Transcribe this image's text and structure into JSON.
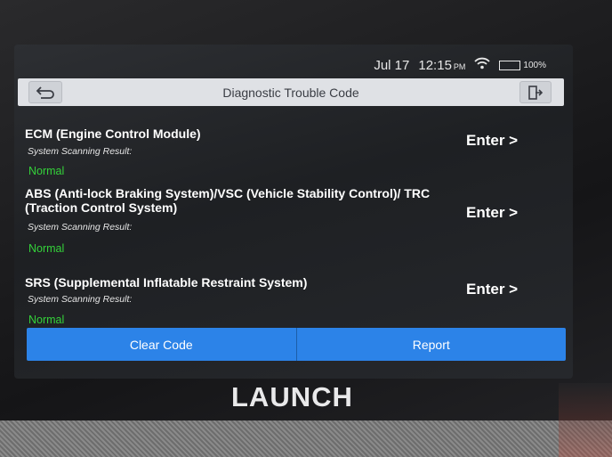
{
  "status_bar": {
    "date": "Jul 17",
    "time": "12:15",
    "ampm": "PM",
    "battery": "100%",
    "icons": [
      "wifi-icon",
      "battery-icon"
    ]
  },
  "title_bar": {
    "title": "Diagnostic Trouble Code",
    "back_icon": "back-arrow-icon",
    "exit_icon": "exit-icon"
  },
  "systems": [
    {
      "name": "ECM (Engine Control Module)",
      "scan_label": "System Scanning Result:",
      "status": "Normal",
      "action": "Enter >"
    },
    {
      "name": "ABS (Anti-lock Braking System)/VSC (Vehicle Stability Control)/ TRC (Traction Control System)",
      "scan_label": "System Scanning Result:",
      "status": "Normal",
      "action": "Enter >"
    },
    {
      "name": "SRS (Supplemental Inflatable Restraint System)",
      "scan_label": "System Scanning Result:",
      "status": "Normal",
      "action": "Enter >"
    }
  ],
  "bottom_bar": {
    "clear_code": "Clear Code",
    "report": "Report"
  },
  "brand": "LAUNCH",
  "colors": {
    "accent": "#2c83e8",
    "status_normal": "#34d23a",
    "title_bar_bg": "#dfe1e5",
    "battery_fill": "#3fcf3f"
  }
}
